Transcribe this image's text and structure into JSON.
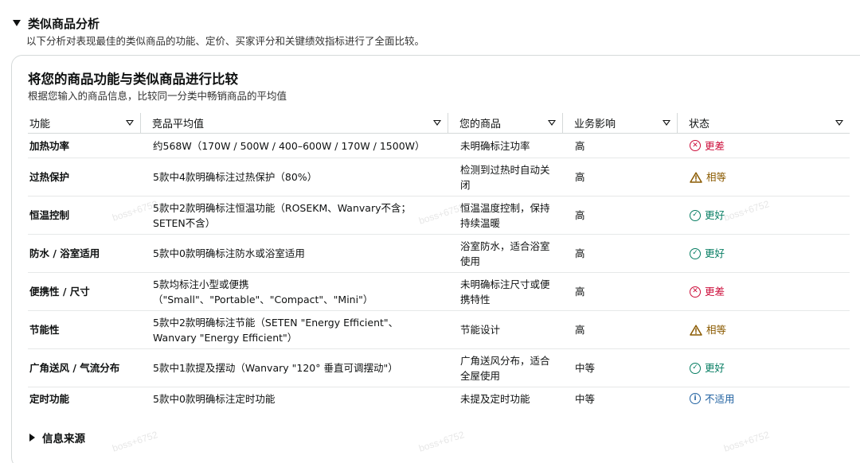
{
  "section": {
    "title": "类似商品分析",
    "description": "以下分析对表现最佳的类似商品的功能、定价、买家评分和关键绩效指标进行了全面比较。"
  },
  "card": {
    "title": "将您的商品功能与类似商品进行比较",
    "subtitle": "根据您输入的商品信息，比较同一分类中畅销商品的平均值"
  },
  "table": {
    "headers": [
      "功能",
      "竞品平均值",
      "您的商品",
      "业务影响",
      "状态"
    ],
    "rows": [
      {
        "feature": "加热功率",
        "competitor": "约568W（170W / 500W / 400–600W / 170W / 1500W）",
        "yours": "未明确标注功率",
        "impact": "高",
        "status": "更差",
        "status_type": "worse"
      },
      {
        "feature": "过热保护",
        "competitor": "5款中4款明确标注过热保护（80%）",
        "yours": "检测到过热时自动关闭",
        "impact": "高",
        "status": "相等",
        "status_type": "equal"
      },
      {
        "feature": "恒温控制",
        "competitor": "5款中2款明确标注恒温功能（ROSEKM、Wanvary不含；SETEN不含）",
        "yours": "恒温温度控制，保持持续温暖",
        "impact": "高",
        "status": "更好",
        "status_type": "better"
      },
      {
        "feature": "防水 / 浴室适用",
        "competitor": "5款中0款明确标注防水或浴室适用",
        "yours": "浴室防水，适合浴室使用",
        "impact": "高",
        "status": "更好",
        "status_type": "better"
      },
      {
        "feature": "便携性 / 尺寸",
        "competitor": "5款均标注小型或便携（\"Small\"、\"Portable\"、\"Compact\"、\"Mini\"）",
        "yours": "未明确标注尺寸或便携特性",
        "impact": "高",
        "status": "更差",
        "status_type": "worse"
      },
      {
        "feature": "节能性",
        "competitor": "5款中2款明确标注节能（SETEN \"Energy Efficient\"、Wanvary \"Energy Efficient\"）",
        "yours": "节能设计",
        "impact": "高",
        "status": "相等",
        "status_type": "equal"
      },
      {
        "feature": "广角送风 / 气流分布",
        "competitor": "5款中1款提及摆动（Wanvary \"120° 垂直可调摆动\"）",
        "yours": "广角送风分布，适合全屋使用",
        "impact": "中等",
        "status": "更好",
        "status_type": "better"
      },
      {
        "feature": "定时功能",
        "competitor": "5款中0款明确标注定时功能",
        "yours": "未提及定时功能",
        "impact": "中等",
        "status": "不适用",
        "status_type": "na"
      }
    ]
  },
  "source": {
    "label": "信息来源"
  },
  "watermark": "boss+6752",
  "colors": {
    "worse": "#cc0c39",
    "better": "#067d62",
    "equal": "#8a5a00",
    "na": "#2162a1",
    "border": "#d5d9d9"
  }
}
